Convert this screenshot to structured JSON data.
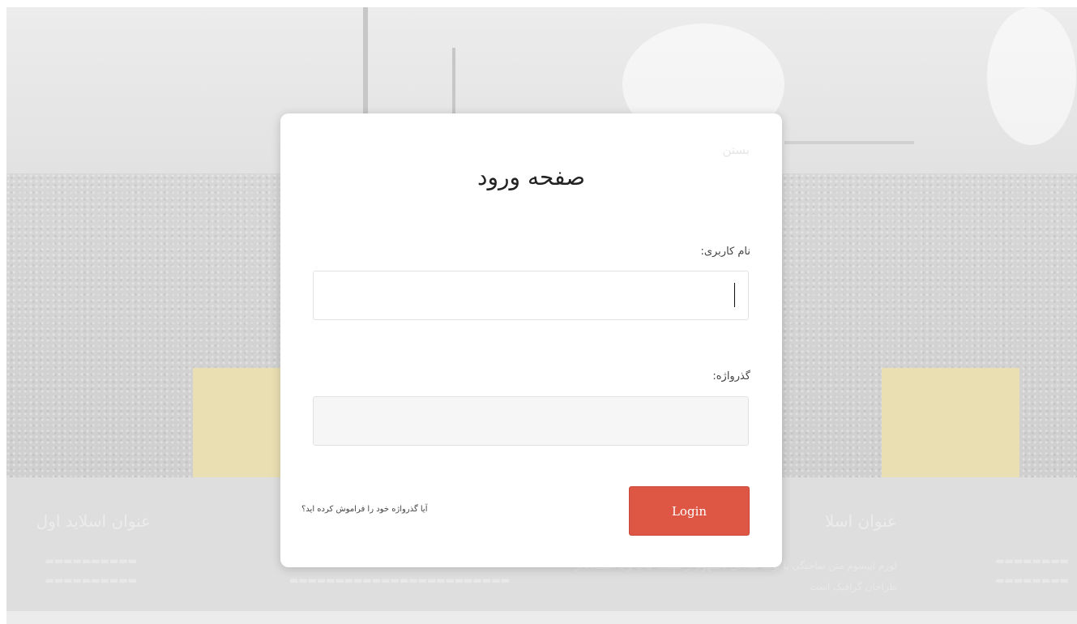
{
  "background": {
    "slides": [
      {
        "title": "عنوان اسلاید اول",
        "text": ""
      },
      {
        "title": "عنوان اسلا",
        "text": "لورم ایپسوم متن ساختگی با تولید سادگی نامفهوم از صنعت چاپ و با استفاده از طراحان گرافیک است"
      }
    ]
  },
  "modal": {
    "back_link": "بستن",
    "title": "صفحه ورود",
    "username": {
      "label": "نام کاربری:",
      "value": "",
      "placeholder": ""
    },
    "password": {
      "label": "گذرواژه:",
      "value": "",
      "placeholder": ""
    },
    "login_label": "Login",
    "forgot_label": "آیا گذرواژه خود را فراموش کرده اید؟"
  },
  "colors": {
    "login_button": "#de5745",
    "overlay": "#e6e6e6"
  }
}
